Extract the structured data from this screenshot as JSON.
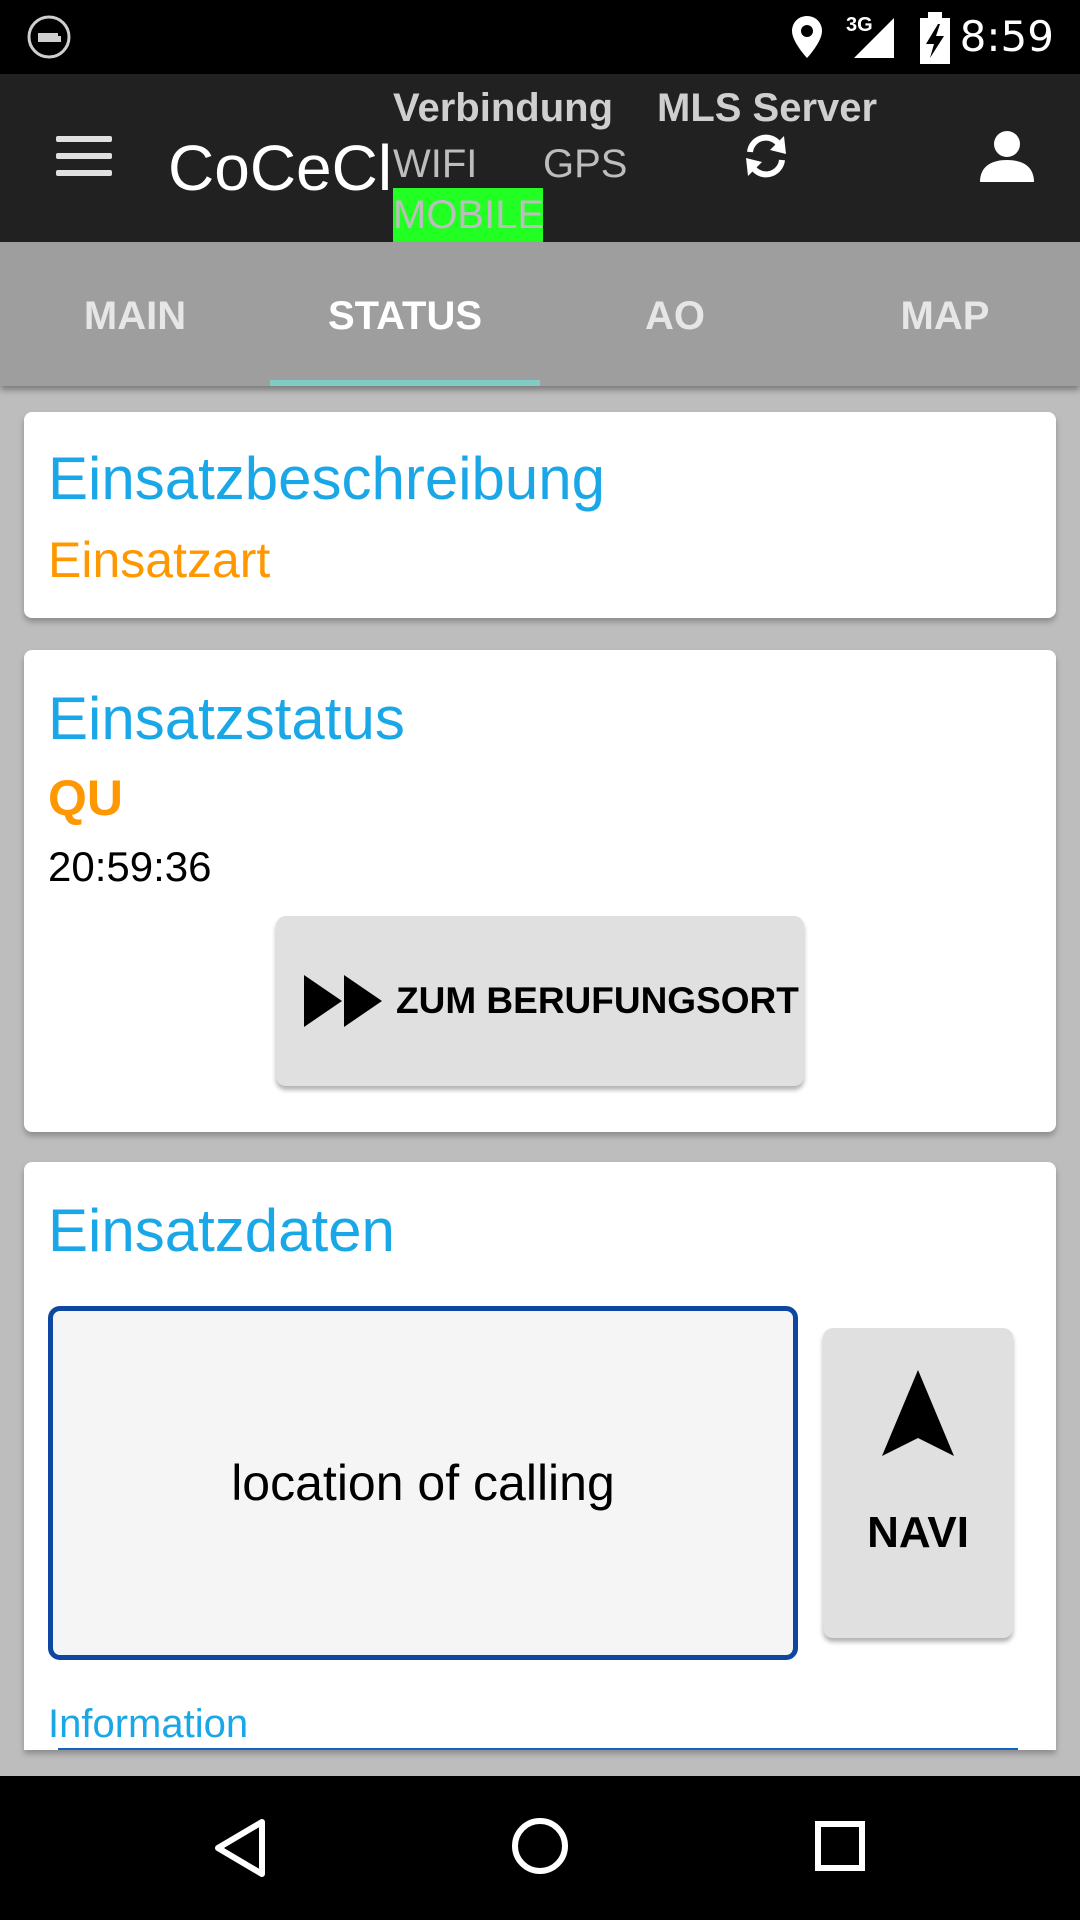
{
  "status_bar": {
    "time": "8:59",
    "network": "3G",
    "icons": [
      "app-notification-icon",
      "location-icon",
      "signal-3g-icon",
      "battery-charging-icon"
    ]
  },
  "app_bar": {
    "title": "CoCeCl",
    "verbindung_label": "Verbindung",
    "mls_server_label": "MLS Server",
    "conn_wifi": "WIFI",
    "conn_gps": "GPS",
    "conn_mobile": "MOBILE",
    "mobile_active_color": "#22ff22",
    "icons": [
      "menu-icon",
      "refresh-icon",
      "account-icon"
    ]
  },
  "tabs": [
    {
      "label": "MAIN",
      "active": false
    },
    {
      "label": "STATUS",
      "active": true
    },
    {
      "label": "AO",
      "active": false
    },
    {
      "label": "MAP",
      "active": false
    }
  ],
  "card_beschreibung": {
    "title": "Einsatzbeschreibung",
    "subtitle": "Einsatzart"
  },
  "card_status": {
    "title": "Einsatzstatus",
    "status_code": "QU",
    "time": "20:59:36",
    "button_label": "ZUM BERUFUNGSORT",
    "button_icon": "fast-forward-icon"
  },
  "card_daten": {
    "title": "Einsatzdaten",
    "location_text": "location of calling",
    "navi_label": "NAVI",
    "navi_icon": "navigation-arrow-icon",
    "information_label": "Information"
  },
  "nav_bar": {
    "icons": [
      "back-icon",
      "home-icon",
      "recents-icon"
    ]
  },
  "colors": {
    "accent_title": "#1aa7e8",
    "accent_orange": "#ff9800",
    "tab_indicator": "#80cbc4",
    "location_border": "#0d47a1"
  }
}
